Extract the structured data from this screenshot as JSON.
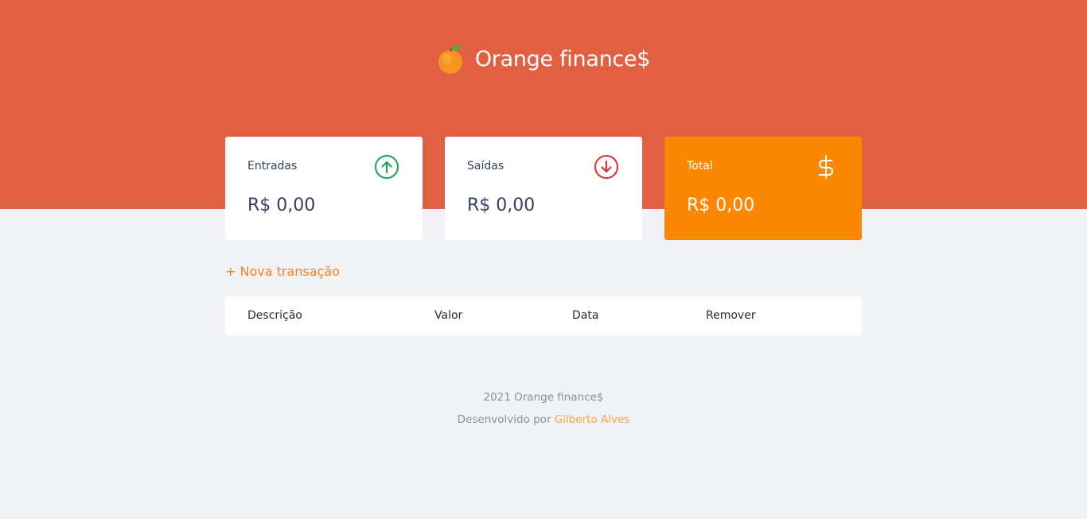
{
  "header": {
    "brand_icon": "orange-fruit-icon",
    "title": "Orange finance$"
  },
  "cards": {
    "income": {
      "label": "Entradas",
      "value": "R$ 0,00",
      "icon": "arrow-up-circle-icon",
      "icon_color": "#12a454"
    },
    "expense": {
      "label": "Saídas",
      "value": "R$ 0,00",
      "icon": "arrow-down-circle-icon",
      "icon_color": "#e92929"
    },
    "total": {
      "label": "Total",
      "value": "R$ 0,00",
      "icon": "dollar-sign-icon",
      "bg_color": "#fb8703"
    }
  },
  "actions": {
    "new_transaction": "+ Nova transação"
  },
  "table": {
    "columns": [
      "Descrição",
      "Valor",
      "Data",
      "Remover"
    ],
    "rows": []
  },
  "footer": {
    "copyright": "2021 Orange finance$",
    "credit_prefix": "Desenvolvido por",
    "author": "Gilberto Alves"
  },
  "colors": {
    "header_bg": "#e16041",
    "page_bg": "#f0f2f5",
    "accent": "#f5821f"
  }
}
